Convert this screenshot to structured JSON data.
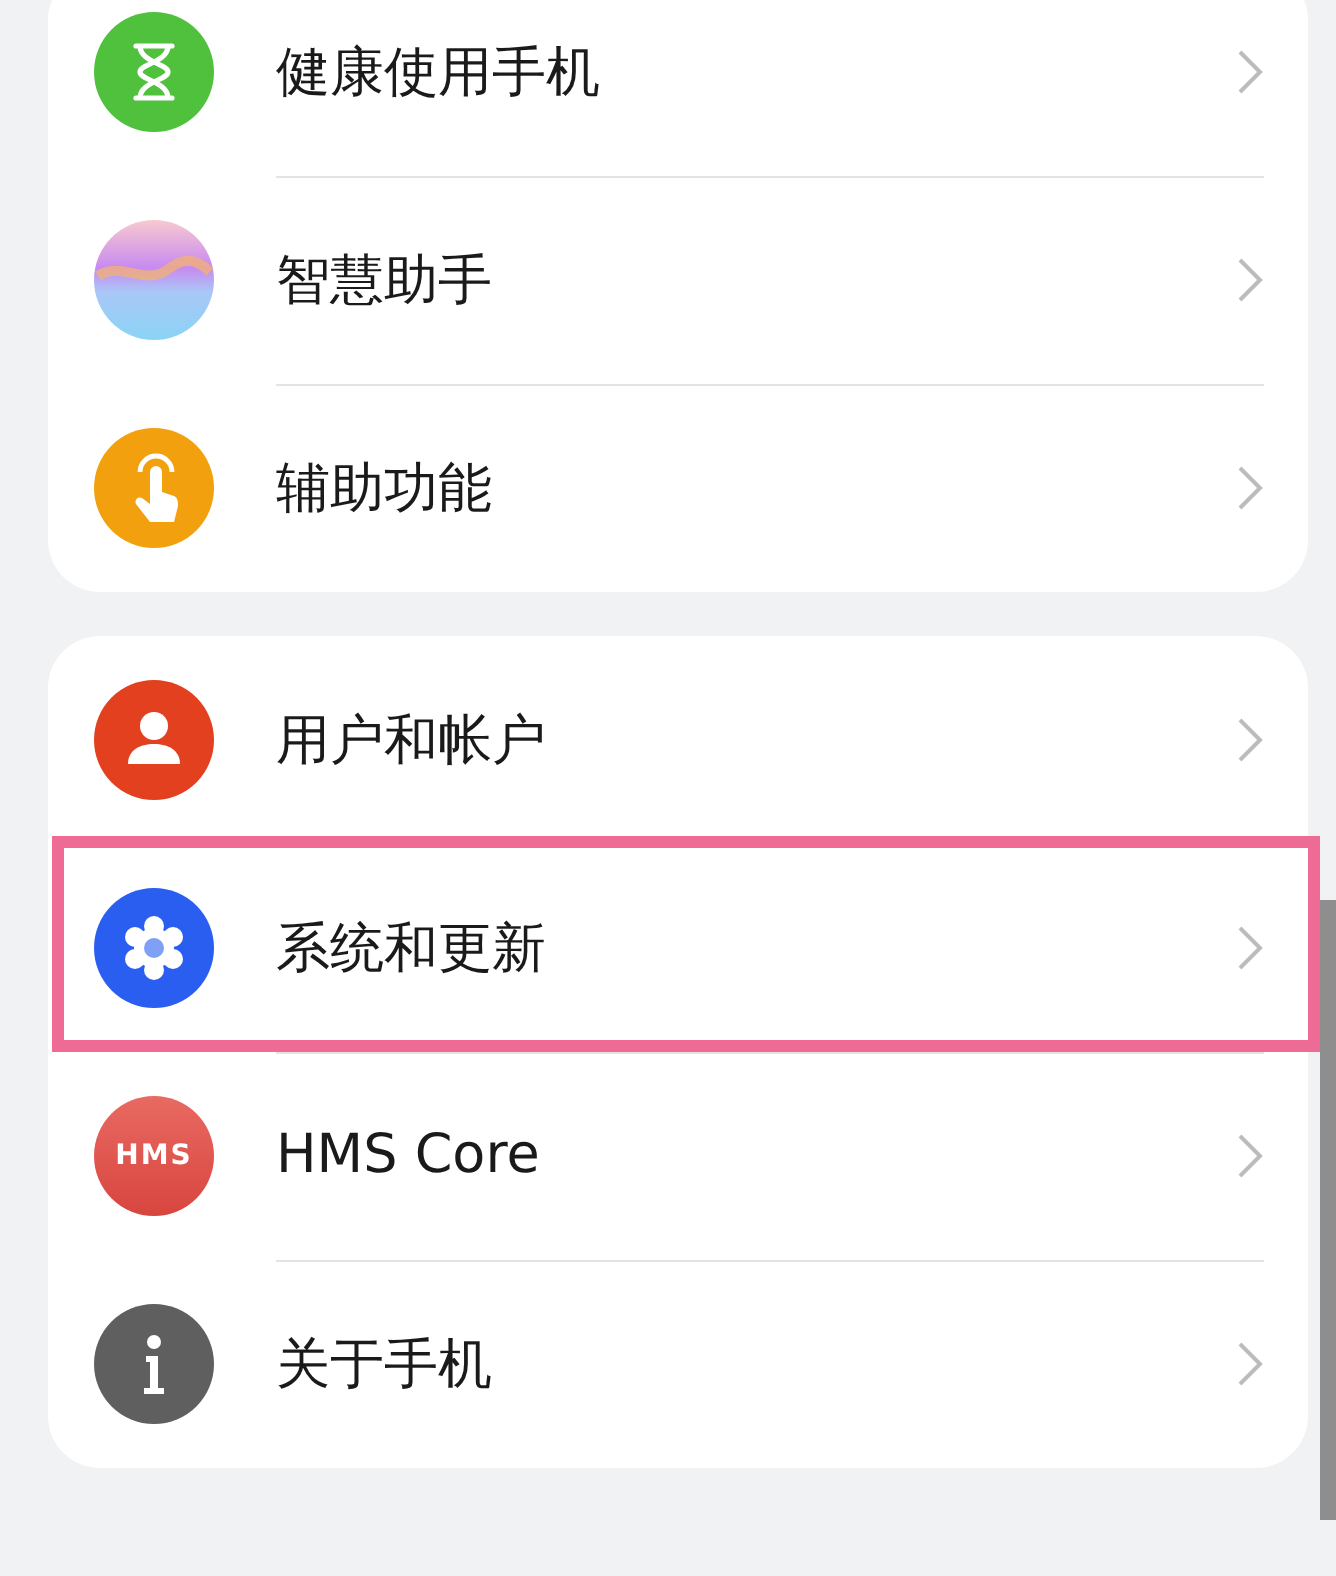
{
  "sections": [
    {
      "items": [
        {
          "kind": "hourglass",
          "label": "健康使用手机",
          "highlighted": false
        },
        {
          "kind": "orb",
          "label": "智慧助手",
          "highlighted": false
        },
        {
          "kind": "hand",
          "label": "辅助功能",
          "highlighted": false
        }
      ]
    },
    {
      "items": [
        {
          "kind": "user",
          "label": "用户和帐户",
          "highlighted": false
        },
        {
          "kind": "gear",
          "label": "系统和更新",
          "highlighted": true
        },
        {
          "kind": "hms",
          "icon_text": "HMS",
          "label": "HMS Core",
          "highlighted": false
        },
        {
          "kind": "info",
          "label": "关于手机",
          "highlighted": false
        }
      ]
    }
  ]
}
